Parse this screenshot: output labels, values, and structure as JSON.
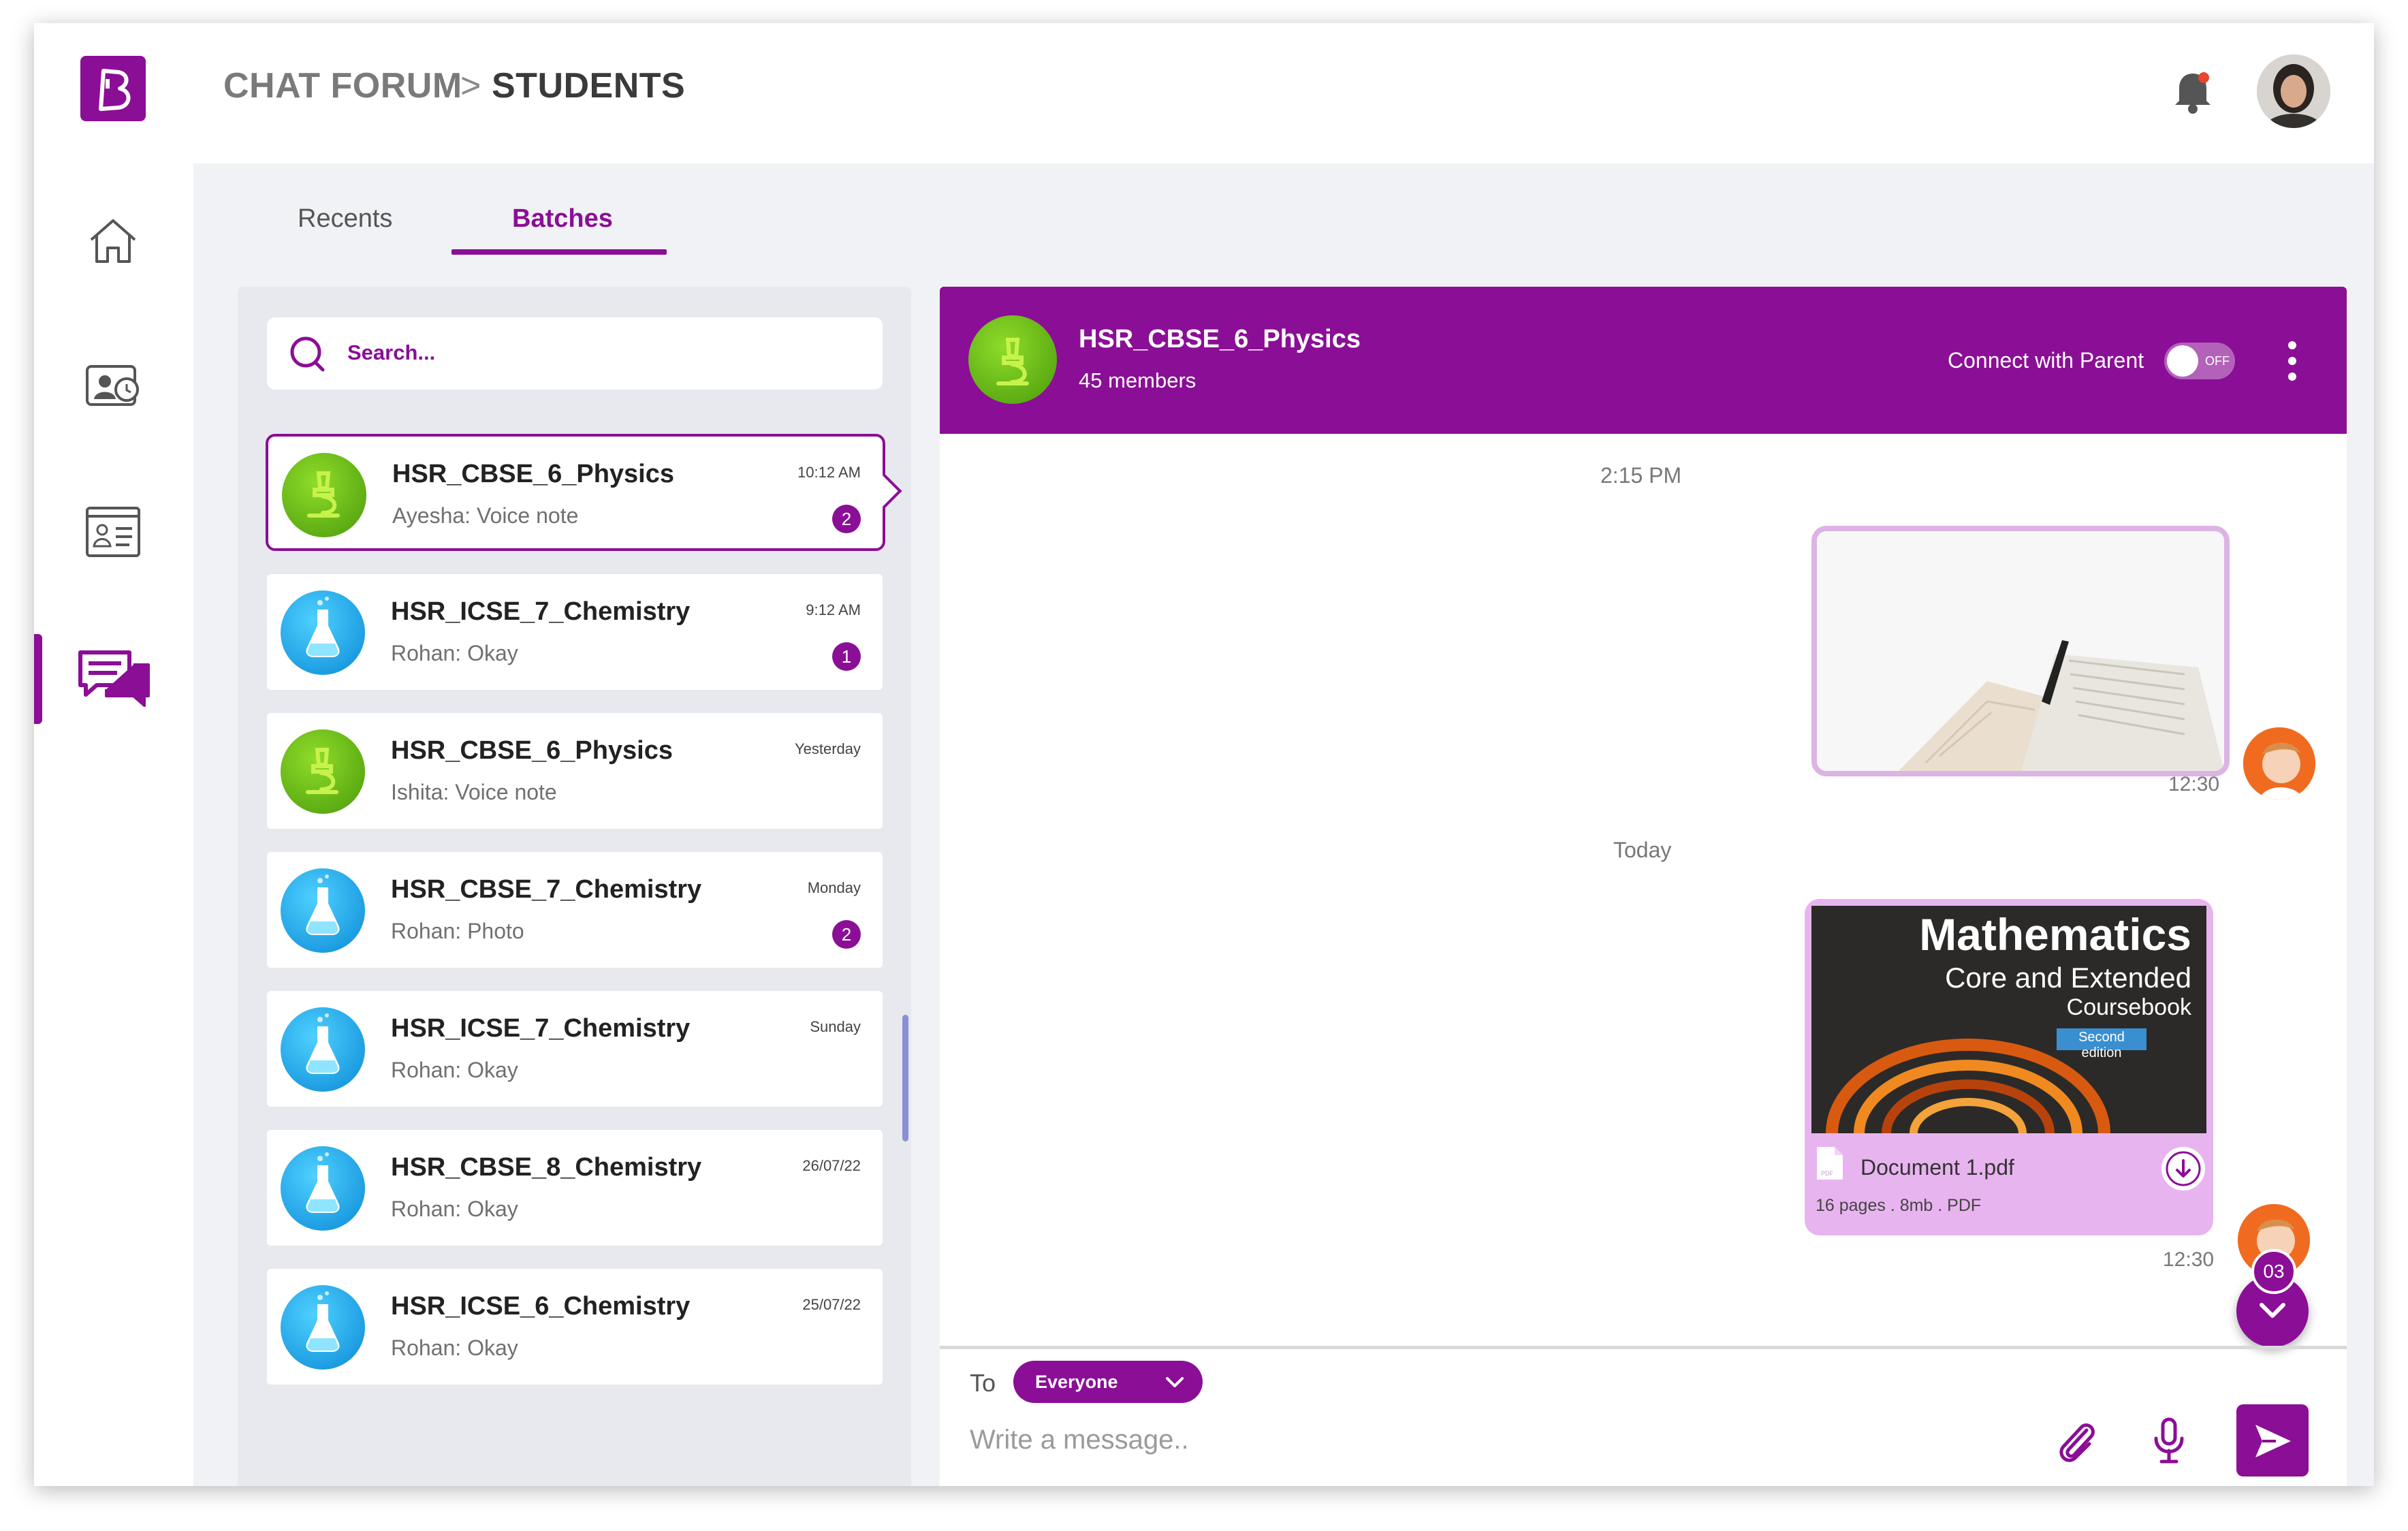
{
  "header": {
    "breadcrumb_root": "CHAT FORUM",
    "breadcrumb_sep": ">",
    "breadcrumb_current": "STUDENTS"
  },
  "tabs": [
    {
      "label": "Recents",
      "active": false
    },
    {
      "label": "Batches",
      "active": true
    }
  ],
  "search": {
    "placeholder": "Search..."
  },
  "conversations": [
    {
      "name": "HSR_CBSE_6_Physics",
      "preview": "Ayesha: Voice note",
      "time": "10:12 AM",
      "badge": "2",
      "icon": "physics-icon"
    },
    {
      "name": "HSR_ICSE_7_Chemistry",
      "preview": "Rohan: Okay",
      "time": "9:12 AM",
      "badge": "1",
      "icon": "chemistry-icon"
    },
    {
      "name": "HSR_CBSE_6_Physics",
      "preview": "Ishita: Voice note",
      "time": "Yesterday",
      "badge": "",
      "icon": "physics-icon"
    },
    {
      "name": "HSR_CBSE_7_Chemistry",
      "preview": "Rohan: Photo",
      "time": "Monday",
      "badge": "2",
      "icon": "chemistry-icon"
    },
    {
      "name": "HSR_ICSE_7_Chemistry",
      "preview": "Rohan: Okay",
      "time": "Sunday",
      "badge": "",
      "icon": "chemistry-icon"
    },
    {
      "name": "HSR_CBSE_8_Chemistry",
      "preview": "Rohan: Okay",
      "time": "26/07/22",
      "badge": "",
      "icon": "chemistry-icon"
    },
    {
      "name": "HSR_ICSE_6_Chemistry",
      "preview": "Rohan: Okay",
      "time": "25/07/22",
      "badge": "",
      "icon": "chemistry-icon"
    }
  ],
  "chat": {
    "title": "HSR_CBSE_6_Physics",
    "members": "45 members",
    "connect_label": "Connect with Parent",
    "toggle_state": "OFF",
    "time_divider_1": "2:15 PM",
    "msg1_time": "12:30",
    "time_divider_2": "Today",
    "book_title": "Mathematics",
    "book_subtitle": "Core and Extended",
    "book_sub2": "Coursebook",
    "book_edition": "Second edition",
    "doc_name": "Document 1.pdf",
    "doc_meta": "16 pages . 8mb . PDF",
    "msg2_time": "12:30",
    "unread_count": "03"
  },
  "composer": {
    "to_label": "To",
    "recipient": "Everyone",
    "placeholder": "Write a message.."
  },
  "colors": {
    "brand": "#8b0e96",
    "physics_green": "#5fb30f",
    "chemistry_blue": "#1aa3e8"
  }
}
